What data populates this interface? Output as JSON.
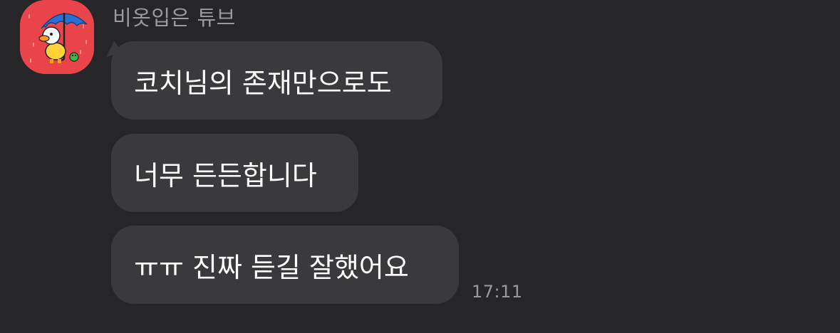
{
  "chat": {
    "sender_name": "비옷입은 튜브",
    "messages": [
      {
        "text": "코치님의 존재만으로도"
      },
      {
        "text": "너무 든든합니다"
      },
      {
        "text": "ㅠㅠ 진짜 듣길 잘했어요"
      }
    ],
    "timestamp": "17:11",
    "avatar_icon": "duck-with-umbrella-icon",
    "colors": {
      "background": "#262628",
      "bubble": "#3a3a3c",
      "avatar_bg": "#e9444a",
      "meta_text": "#9a9a9c"
    }
  }
}
